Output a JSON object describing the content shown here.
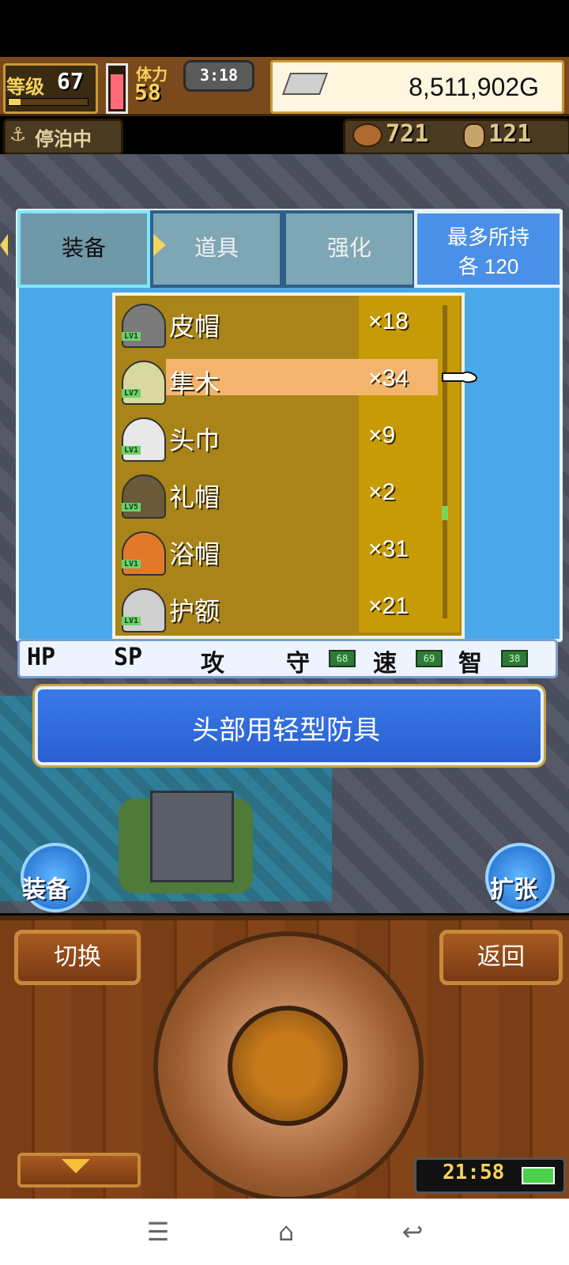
{
  "status": {
    "level_label": "等级",
    "level": "67",
    "stamina_label": "体力",
    "stamina": "58",
    "clock": "3:18",
    "money": "8,511,902G",
    "dock_status": "停泊中",
    "food": "721",
    "wood": "121"
  },
  "tabs": [
    {
      "label": "装备"
    },
    {
      "label": "道具"
    },
    {
      "label": "强化"
    }
  ],
  "max_hold": {
    "line1": "最多所持",
    "line2": "各 120"
  },
  "items": [
    {
      "name": "皮帽",
      "qty": "×18",
      "lv": "LV1"
    },
    {
      "name": "隼木",
      "qty": "×34",
      "lv": "LV7"
    },
    {
      "name": "头巾",
      "qty": "×9",
      "lv": "LV1"
    },
    {
      "name": "礼帽",
      "qty": "×2",
      "lv": "LV5"
    },
    {
      "name": "浴帽",
      "qty": "×31",
      "lv": "LV1"
    },
    {
      "name": "护额",
      "qty": "×21",
      "lv": "LV1"
    }
  ],
  "stats": {
    "hp": "HP",
    "sp": "SP",
    "atk": "攻",
    "def": "守",
    "def_val": "68",
    "spd": "速",
    "spd_val": "69",
    "int": "智",
    "int_val": "38"
  },
  "description": "头部用轻型防具",
  "side_buttons": {
    "equip": "装备",
    "expand": "扩张"
  },
  "controls": {
    "switch": "切换",
    "back": "返回"
  },
  "device_time": "21:58",
  "level_progress": 0.15,
  "hp_fill": 0.85,
  "colors": {
    "panel": "#4aa8e8",
    "list": "#a98418",
    "selected_row": "#f3b46e",
    "description": "#2a5fd0"
  }
}
